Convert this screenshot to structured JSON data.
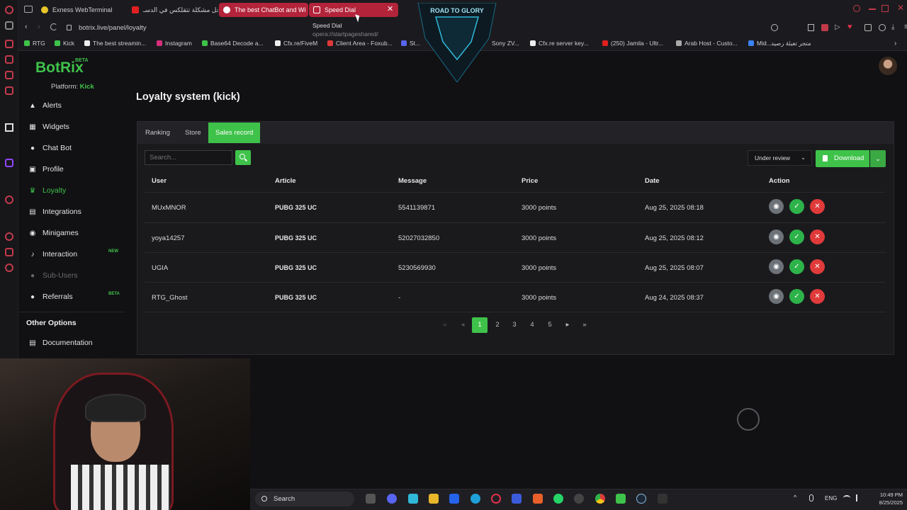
{
  "browser": {
    "tabs": [
      {
        "label": "Exness WebTerminal",
        "active": false
      },
      {
        "label": "حل مشكلة تتقلكس في الدسـ",
        "active": false
      },
      {
        "label": "The best ChatBot and Wi",
        "active": false
      },
      {
        "label": "Speed Dial",
        "active": true
      }
    ],
    "tooltip": {
      "title": "Speed Dial",
      "url": "opera://startpageshared/"
    },
    "url": "botrix.live/panel/loyalty",
    "banner_text": "ROAD TO GLORY",
    "bookmarks": [
      "RTG",
      "Kick",
      "The best streamin...",
      "Instagram",
      "Base64 Decode a...",
      "Cfx.re/FiveM",
      "Client Area - Foxub...",
      "St...",
      "Sony ZV...",
      "Cfx.re server key...",
      "(250) Jamila - Ultr...",
      "Arab Host - Custo...",
      "Mid...",
      "متجر تعبئة رصيد"
    ]
  },
  "app": {
    "brand": "BotRix",
    "brand_badge": "BETA",
    "platform_label": "Platform:",
    "platform_value": "Kick",
    "nav": [
      {
        "label": "Alerts",
        "icon": "warning-icon"
      },
      {
        "label": "Widgets",
        "icon": "grid-icon"
      },
      {
        "label": "Chat Bot",
        "icon": "robot-icon"
      },
      {
        "label": "Profile",
        "icon": "id-card-icon"
      },
      {
        "label": "Loyalty",
        "icon": "trophy-icon",
        "active": true
      },
      {
        "label": "Integrations",
        "icon": "plug-icon"
      },
      {
        "label": "Minigames",
        "icon": "gamepad-icon"
      },
      {
        "label": "Interaction",
        "icon": "music-icon",
        "badge": "NEW"
      },
      {
        "label": "Sub-Users",
        "icon": "users-icon",
        "disabled": true
      },
      {
        "label": "Referrals",
        "icon": "users-icon",
        "badge": "BETA"
      }
    ],
    "other_options_heading": "Other Options",
    "other_options": [
      {
        "label": "Documentation",
        "icon": "document-icon"
      }
    ],
    "colors": {
      "accent": "#3fc24a",
      "danger": "#e03a3a",
      "muted": "#6d7278"
    }
  },
  "main": {
    "title": "Loyalty system (kick)",
    "tabs": [
      {
        "label": "Ranking"
      },
      {
        "label": "Store"
      },
      {
        "label": "Sales record",
        "active": true
      }
    ],
    "search_placeholder": "Search...",
    "status_filter": "Under review",
    "download_label": "Download",
    "table": {
      "headers": [
        "User",
        "Article",
        "Message",
        "Price",
        "Date",
        "Action"
      ],
      "rows": [
        {
          "user": "MUxMNOR",
          "article": "PUBG 325 UC",
          "message": "5541139871",
          "price": "3000 points",
          "date": "Aug 25, 2025 08:18"
        },
        {
          "user": "yoya14257",
          "article": "PUBG 325 UC",
          "message": "52027032850",
          "price": "3000 points",
          "date": "Aug 25, 2025 08:12"
        },
        {
          "user": "UGIA",
          "article": "PUBG 325 UC",
          "message": "5230569930",
          "price": "3000 points",
          "date": "Aug 25, 2025 08:07"
        },
        {
          "user": "RTG_Ghost",
          "article": "PUBG 325 UC",
          "message": "-",
          "price": "3000 points",
          "date": "Aug 24, 2025 08:37"
        }
      ]
    },
    "pagination": {
      "pages": [
        "1",
        "2",
        "3",
        "4",
        "5"
      ],
      "current": "1"
    }
  },
  "taskbar": {
    "search_label": "Search",
    "lang": "ENG",
    "time": "10:49 PM",
    "date": "8/25/2025"
  }
}
